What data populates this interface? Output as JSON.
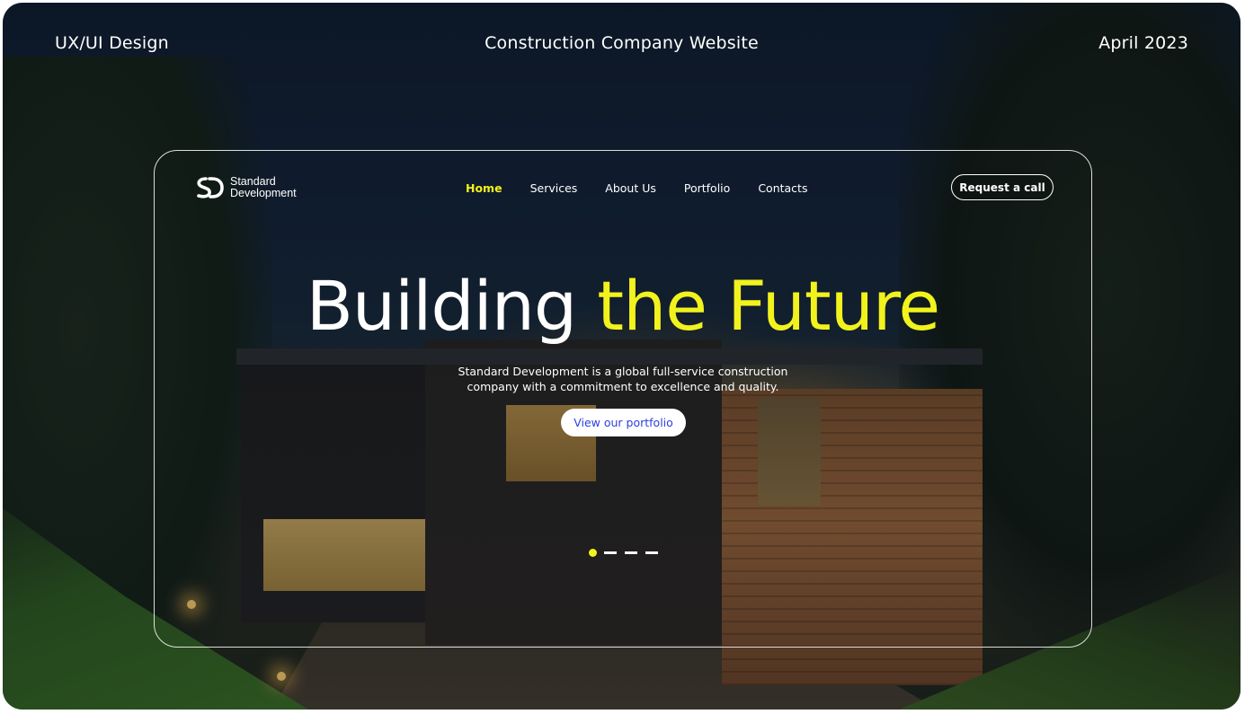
{
  "presentation": {
    "left_label": "UX/UI Design",
    "center_label": "Construction Company Website",
    "right_label": "April 2023"
  },
  "header": {
    "logo_text": "Standard\nDevelopment",
    "nav": [
      {
        "label": "Home",
        "active": true
      },
      {
        "label": "Services",
        "active": false
      },
      {
        "label": "About Us",
        "active": false
      },
      {
        "label": "Portfolio",
        "active": false
      },
      {
        "label": "Contacts",
        "active": false
      }
    ],
    "cta_label": "Request a call"
  },
  "hero": {
    "title_plain": "Building",
    "title_accent": "the Future",
    "subtitle": "Standard Development is a global full-service construction company with a commitment to excellence and quality.",
    "cta_label": "View our portfolio"
  },
  "slider": {
    "total": 4,
    "active_index": 0
  },
  "colors": {
    "accent": "#f2f21d",
    "cta_text": "#2b3fe0",
    "text": "#ffffff"
  },
  "icons": {
    "logo_mark": "sd-monogram-icon"
  }
}
